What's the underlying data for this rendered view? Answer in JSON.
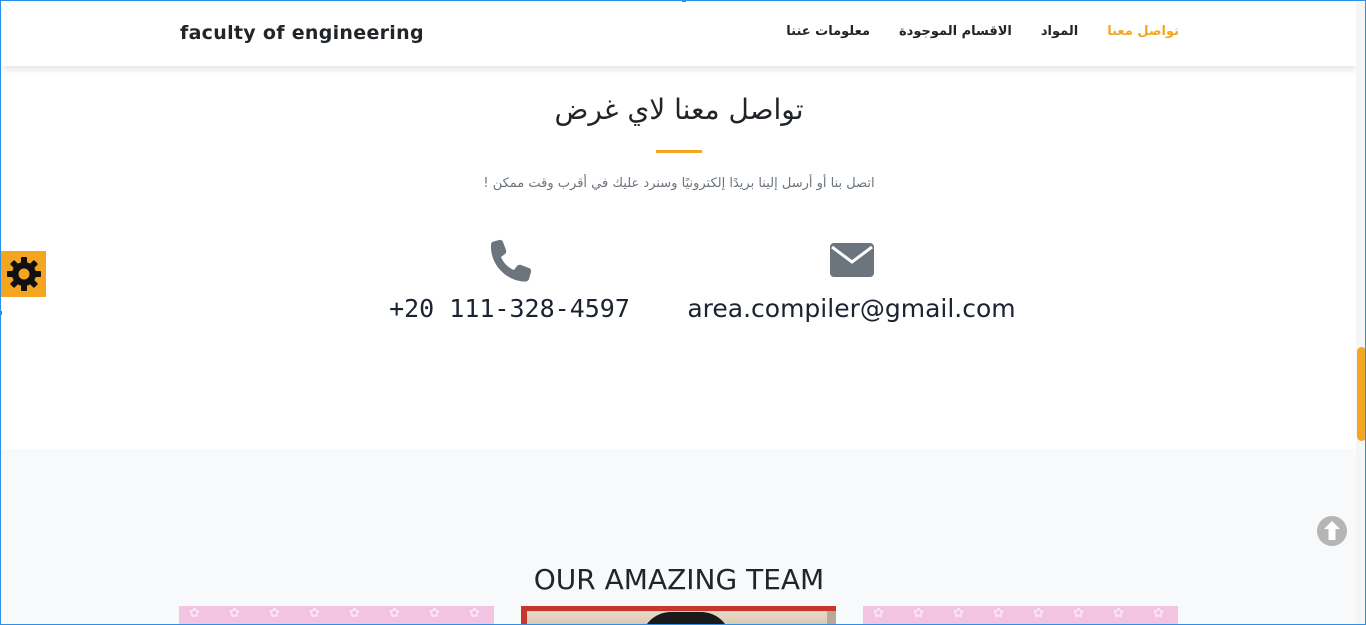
{
  "navbar": {
    "brand": "faculty of engineering",
    "links": [
      {
        "label": "تواصل معنا",
        "active": true
      },
      {
        "label": "المواد",
        "active": false
      },
      {
        "label": "الاقسام الموجودة",
        "active": false
      },
      {
        "label": "معلومات عننا",
        "active": false
      }
    ]
  },
  "contact": {
    "heading": "تواصل معنا لاي غرض",
    "lead": "اتصل بنا أو أرسل إلينا بريدًا إلكترونيًا وسنرد عليك في أقرب وقت ممكن !",
    "phone": {
      "icon": "phone-icon",
      "value": "+20 111-328-4597"
    },
    "email": {
      "icon": "envelope-icon",
      "value": "area.compiler@gmail.com"
    }
  },
  "team": {
    "heading": "OUR AMAZING TEAM"
  },
  "floating": {
    "settings_icon": "gear-icon",
    "scroll_top_icon": "arrow-up-circle-icon"
  },
  "colors": {
    "accent": "#f4a623",
    "text_dark": "#212529",
    "text_muted": "#6c757d",
    "icon_gray": "#6c757d",
    "team_bg": "#f8f9fa",
    "card_pink": "#f2c4e2"
  }
}
